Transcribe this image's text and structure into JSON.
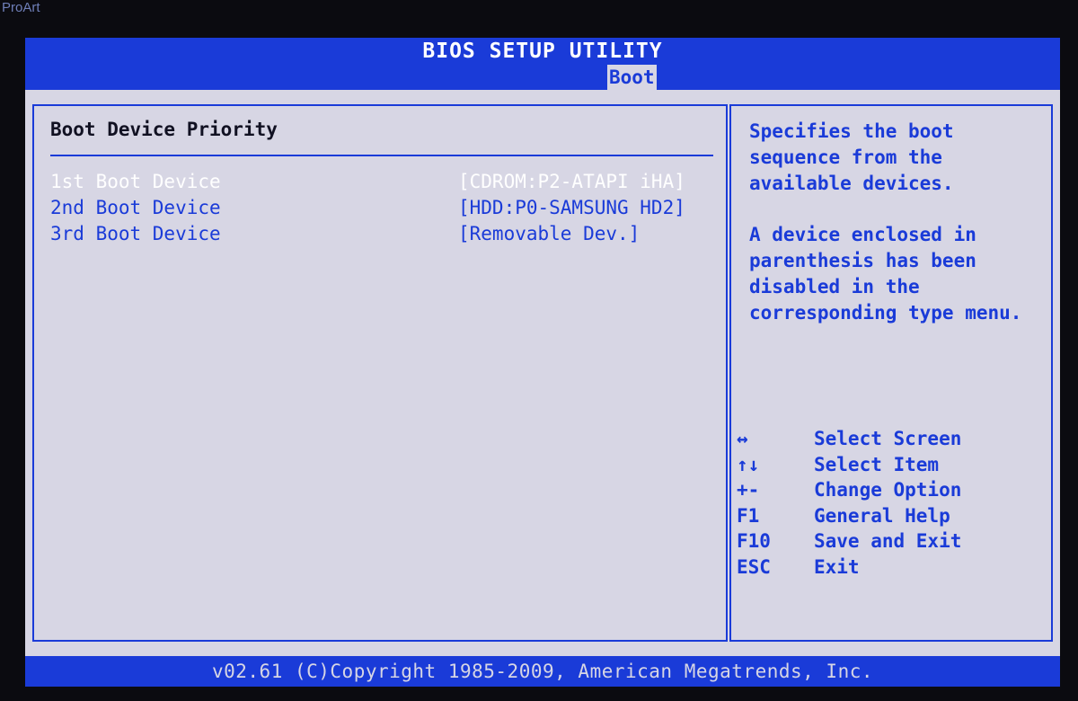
{
  "monitor": {
    "brand": "ProArt"
  },
  "header": {
    "title": "BIOS SETUP UTILITY",
    "active_tab": "Boot"
  },
  "main": {
    "section_title": "Boot Device Priority",
    "items": [
      {
        "label": "1st Boot Device",
        "value": "[CDROM:P2-ATAPI iHA]",
        "selected": true
      },
      {
        "label": "2nd Boot Device",
        "value": "[HDD:P0-SAMSUNG HD2]",
        "selected": false
      },
      {
        "label": "3rd Boot Device",
        "value": "[Removable Dev.]",
        "selected": false
      }
    ]
  },
  "help": {
    "paragraph1": "Specifies the boot sequence from the available devices.",
    "paragraph2": "A device enclosed in parenthesis has been disabled in the corresponding type menu."
  },
  "keys": [
    {
      "key": "↔",
      "icon": "left-right-arrow-icon",
      "action": "Select Screen"
    },
    {
      "key": "↑↓",
      "icon": "up-down-arrow-icon",
      "action": "Select Item"
    },
    {
      "key": "+-",
      "icon": "plus-minus-icon",
      "action": "Change Option"
    },
    {
      "key": "F1",
      "icon": "",
      "action": "General Help"
    },
    {
      "key": "F10",
      "icon": "",
      "action": "Save and Exit"
    },
    {
      "key": "ESC",
      "icon": "",
      "action": "Exit"
    }
  ],
  "footer": {
    "copyright": "v02.61 (C)Copyright 1985-2009, American Megatrends, Inc."
  },
  "colors": {
    "bios_blue": "#1a3bd8",
    "panel_bg": "#d7d6e4",
    "selected_text": "#ffffff"
  }
}
